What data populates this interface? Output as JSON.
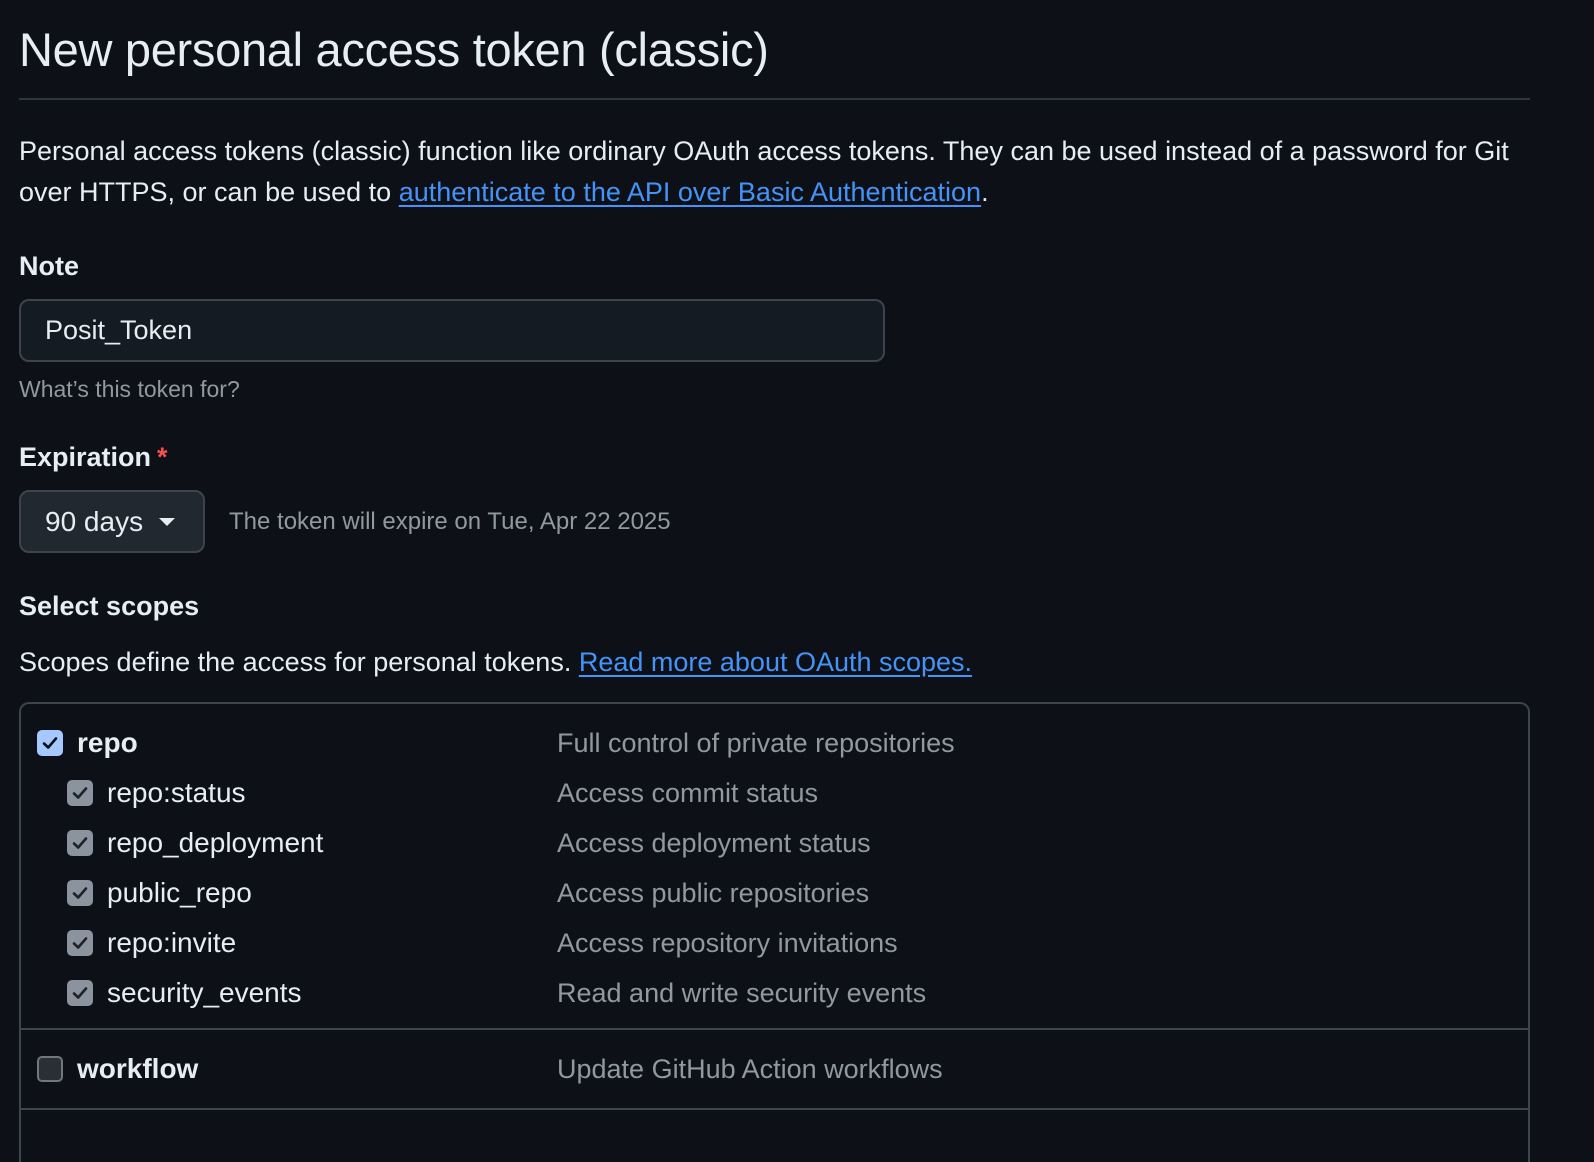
{
  "page": {
    "title": "New personal access token (classic)",
    "intro_text": "Personal access tokens (classic) function like ordinary OAuth access tokens. They can be used instead of a password for Git over HTTPS, or can be used to ",
    "intro_link": "authenticate to the API over Basic Authentication",
    "intro_end": "."
  },
  "note": {
    "label": "Note",
    "value": "Posit_Token",
    "hint": "What’s this token for?"
  },
  "expiration": {
    "label": "Expiration",
    "required_mark": "*",
    "selected": "90 days",
    "info": "The token will expire on Tue, Apr 22 2025"
  },
  "scopes": {
    "label": "Select scopes",
    "description": "Scopes define the access for personal tokens. ",
    "link": "Read more about OAuth scopes.",
    "groups": [
      {
        "name": "repo",
        "desc": "Full control of private repositories",
        "checked": true,
        "children": [
          {
            "name": "repo:status",
            "desc": "Access commit status",
            "checked": true
          },
          {
            "name": "repo_deployment",
            "desc": "Access deployment status",
            "checked": true
          },
          {
            "name": "public_repo",
            "desc": "Access public repositories",
            "checked": true
          },
          {
            "name": "repo:invite",
            "desc": "Access repository invitations",
            "checked": true
          },
          {
            "name": "security_events",
            "desc": "Read and write security events",
            "checked": true
          }
        ]
      },
      {
        "name": "workflow",
        "desc": "Update GitHub Action workflows",
        "checked": false,
        "children": []
      }
    ]
  },
  "colors": {
    "background": "#0d1117",
    "link": "#4493f8",
    "required": "#f85149",
    "checkbox_checked": "#a5c8ff"
  }
}
